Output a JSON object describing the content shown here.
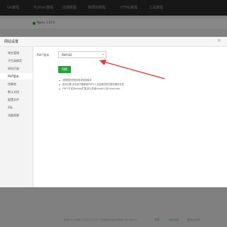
{
  "topnav": {
    "items": [
      "Git教程",
      "Python教程",
      "前端教程",
      "数据库教程",
      "HTML教程",
      "工具教程"
    ]
  },
  "crumb": {
    "text": "Nginx 1.22.0"
  },
  "modal": {
    "title": "网站设置",
    "close": "×",
    "sidebar": [
      "域名管理",
      "子目录绑定",
      "网站目录",
      "流量限制",
      "伪静态",
      "默认文档",
      "配置文件",
      "SSL",
      "PHP版本"
    ],
    "active_item": 8,
    "php_version_label": "PHP 版本",
    "php_version_value": "PHP-82",
    "save_label": "切换",
    "notes": [
      "请根据您的程序需求选择版本",
      "若非必要,请尽量不要使用PHP5.2,这会降低您的服务器安全性",
      "PHP7不支持mysql扩展,默认安装mysqli以及mysql-pdo"
    ]
  },
  "footer": {
    "text": "宝塔Linux面板 ©2014-2024 广东堡塔安全技术有限公司 (bt.cn)",
    "links": [
      "求助",
      "使用手册",
      "微信公众号"
    ]
  },
  "colors": {
    "accent": "#20a53a",
    "arrow": "#e53935"
  }
}
